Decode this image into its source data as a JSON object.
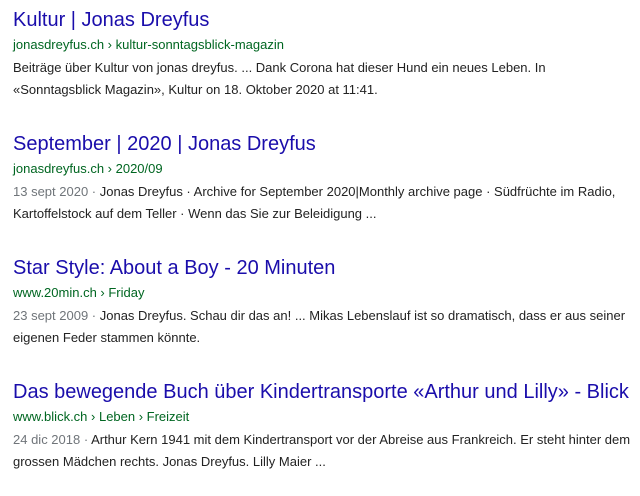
{
  "results": [
    {
      "title": "Kultur | Jonas Dreyfus",
      "cite": "jonasdreyfus.ch › kultur-sonntagsblick-magazin",
      "date": "",
      "snippet": "Beiträge über Kultur von jonas dreyfus. ... Dank Corona hat dieser Hund ein neues Leben. In «Sonntagsblick Magazin», Kultur on 18. Oktober 2020 at 11:41."
    },
    {
      "title": "September | 2020 | Jonas Dreyfus",
      "cite": "jonasdreyfus.ch › 2020/09",
      "date": "13 sept 2020 · ",
      "snippet": "Jonas Dreyfus · Archive for September 2020|Monthly archive page · Südfrüchte im Radio, Kartoffelstock auf dem Teller · Wenn das Sie zur Beleidigung ..."
    },
    {
      "title": "Star Style: About a Boy - 20 Minuten",
      "cite": "www.20min.ch › Friday",
      "date": "23 sept 2009 · ",
      "snippet": "Jonas Dreyfus. Schau dir das an! ... Mikas Lebenslauf ist so dramatisch, dass er aus seiner eigenen Feder stammen könnte."
    },
    {
      "title": "Das bewegende Buch über Kindertransporte «Arthur und Lilly» - Blick",
      "cite": "www.blick.ch › Leben › Freizeit",
      "date": "24 dic 2018 · ",
      "snippet": "Arthur Kern 1941 mit dem Kindertransport vor der Abreise aus Frankreich. Er steht hinter dem grossen Mädchen rechts. Jonas Dreyfus. Lilly Maier ..."
    }
  ],
  "colors": {
    "title": "#1a0dab",
    "cite": "#006621",
    "snippet": "#222222",
    "date": "#70757a"
  }
}
